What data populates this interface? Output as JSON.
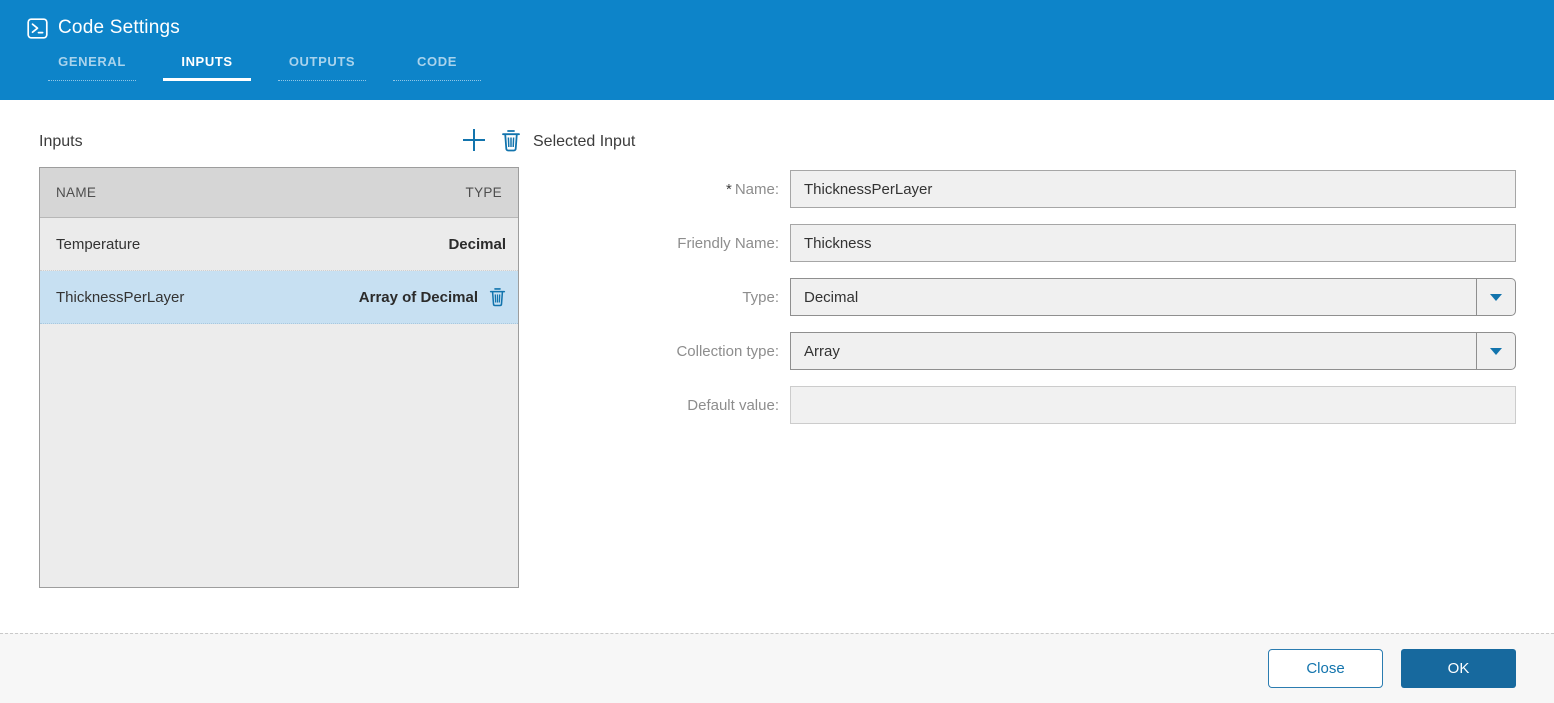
{
  "header": {
    "title": "Code Settings",
    "icon": "terminal-icon",
    "tabs": [
      {
        "label": "GENERAL",
        "active": false
      },
      {
        "label": "INPUTS",
        "active": true
      },
      {
        "label": "OUTPUTS",
        "active": false
      },
      {
        "label": "CODE",
        "active": false
      }
    ]
  },
  "inputs_panel": {
    "title": "Inputs",
    "toolbar": {
      "add_icon": "plus-icon",
      "delete_icon": "trash-icon"
    },
    "table": {
      "columns": {
        "name": "NAME",
        "type": "TYPE"
      },
      "rows": [
        {
          "name": "Temperature",
          "type": "Decimal",
          "selected": false
        },
        {
          "name": "ThicknessPerLayer",
          "type": "Array of Decimal",
          "selected": true
        }
      ]
    }
  },
  "selected_input": {
    "title": "Selected Input",
    "required_marker": "*",
    "fields": [
      {
        "label": "Name:",
        "value": "ThicknessPerLayer",
        "control": "text",
        "required": true
      },
      {
        "label": "Friendly Name:",
        "value": "Thickness",
        "control": "text",
        "required": false
      },
      {
        "label": "Type:",
        "value": "Decimal",
        "control": "dropdown",
        "required": false
      },
      {
        "label": "Collection type:",
        "value": "Array",
        "control": "dropdown",
        "required": false
      },
      {
        "label": "Default value:",
        "value": "",
        "control": "text",
        "required": false,
        "disabled": true
      }
    ]
  },
  "footer": {
    "close_label": "Close",
    "ok_label": "OK"
  },
  "colors": {
    "header_blue": "#0d84c9",
    "accent_blue": "#1274ad",
    "ok_button_blue": "#17699e",
    "selected_row_blue": "#c7e0f2",
    "list_bg": "#ececec",
    "list_header_bg": "#d6d6d6",
    "input_bg": "#f0f0f0"
  }
}
